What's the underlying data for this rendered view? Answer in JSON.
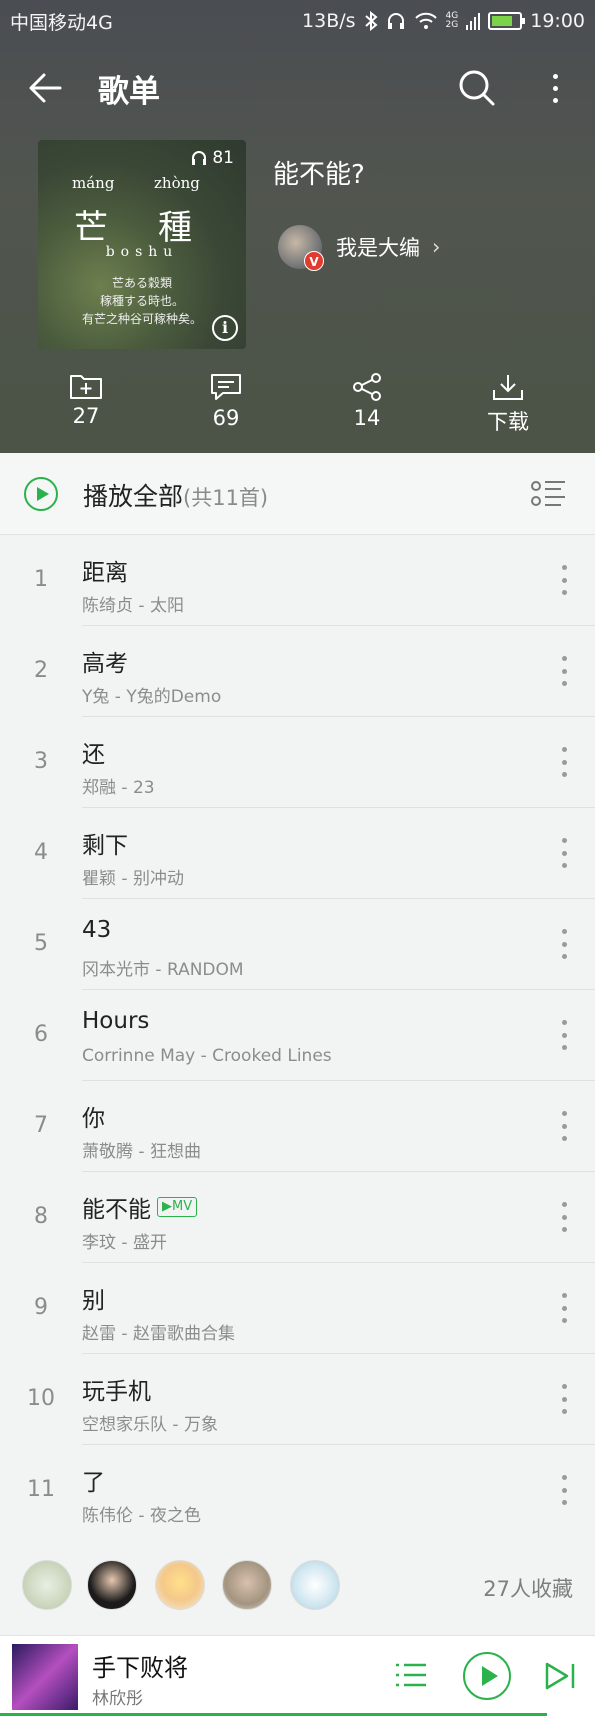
{
  "status_bar": {
    "carrier": "中国移动4G",
    "speed": "13B/s",
    "network_small_top": "4G",
    "network_small_bottom": "2G",
    "time": "19:00"
  },
  "toolbar": {
    "title": "歌单"
  },
  "playlist": {
    "cover": {
      "play_count": "81",
      "pinyin_left": "máng",
      "pinyin_right": "zhòng",
      "hanzi_left": "芒",
      "hanzi_right": "種",
      "subtitle": "boshu",
      "poem_line1": "芒ある穀類",
      "poem_line2": "稼種する時也。",
      "poem_line3": "有芒之种谷可稼种矣。"
    },
    "name": "能不能?",
    "creator_name": "我是大编",
    "creator_badge": "V",
    "chevron": "›"
  },
  "actions": {
    "collect_count": "27",
    "comment_count": "69",
    "share_count": "14",
    "download_label": "下载"
  },
  "play_all": {
    "label": "播放全部",
    "count": "(共11首)"
  },
  "songs": [
    {
      "index": "1",
      "title": "距离",
      "subtitle": "陈绮贞 - 太阳"
    },
    {
      "index": "2",
      "title": "高考",
      "subtitle": "Y兔 - Y兔的Demo"
    },
    {
      "index": "3",
      "title": "还",
      "subtitle": "郑融 - 23"
    },
    {
      "index": "4",
      "title": "剩下",
      "subtitle": "瞿颖 - 别冲动"
    },
    {
      "index": "5",
      "title": "43",
      "subtitle": "冈本光市 - RANDOM"
    },
    {
      "index": "6",
      "title": "Hours",
      "subtitle": "Corrinne May - Crooked Lines"
    },
    {
      "index": "7",
      "title": "你",
      "subtitle": "萧敬腾 - 狂想曲"
    },
    {
      "index": "8",
      "title": "能不能",
      "subtitle": "李玟 - 盛开",
      "badge": "▶MV"
    },
    {
      "index": "9",
      "title": "别",
      "subtitle": "赵雷 - 赵雷歌曲合集"
    },
    {
      "index": "10",
      "title": "玩手机",
      "subtitle": "空想家乐队 - 万象"
    },
    {
      "index": "11",
      "title": "了",
      "subtitle": "陈伟伦 - 夜之色"
    }
  ],
  "subscribers": {
    "count_label": "27人收藏"
  },
  "player": {
    "title": "手下败将",
    "artist": "林欣彤",
    "progress": 0.92
  },
  "colors": {
    "accent": "#2bb24c",
    "header_bg": "#4b5048"
  }
}
